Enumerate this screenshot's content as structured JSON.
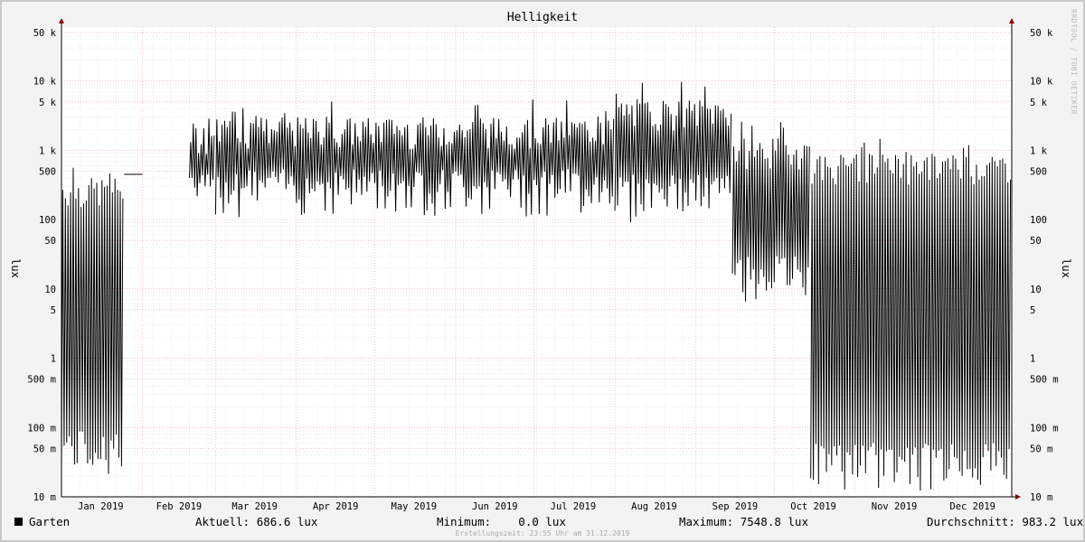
{
  "chart_data": {
    "type": "line",
    "title": "Helligkeit",
    "ylabel": "lux",
    "y_scale": "log",
    "ylim": [
      0.01,
      60000
    ],
    "y_ticks": [
      {
        "value": 50000,
        "label": "50 k"
      },
      {
        "value": 10000,
        "label": "10 k"
      },
      {
        "value": 5000,
        "label": "5 k"
      },
      {
        "value": 1000,
        "label": "1 k"
      },
      {
        "value": 500,
        "label": "500"
      },
      {
        "value": 100,
        "label": "100"
      },
      {
        "value": 50,
        "label": "50"
      },
      {
        "value": 10,
        "label": "10"
      },
      {
        "value": 5,
        "label": "5"
      },
      {
        "value": 1,
        "label": "1"
      },
      {
        "value": 0.5,
        "label": "500 m"
      },
      {
        "value": 0.1,
        "label": "100 m"
      },
      {
        "value": 0.05,
        "label": "50 m"
      },
      {
        "value": 0.01,
        "label": "10 m"
      }
    ],
    "x_range": [
      "2019-01-01",
      "2019-12-31"
    ],
    "x_ticks": [
      {
        "date": "2019-01-16",
        "label": "Jan 2019"
      },
      {
        "date": "2019-02-15",
        "label": "Feb 2019"
      },
      {
        "date": "2019-03-16",
        "label": "Mar 2019"
      },
      {
        "date": "2019-04-16",
        "label": "Apr 2019"
      },
      {
        "date": "2019-05-16",
        "label": "May 2019"
      },
      {
        "date": "2019-06-16",
        "label": "Jun 2019"
      },
      {
        "date": "2019-07-16",
        "label": "Jul 2019"
      },
      {
        "date": "2019-08-16",
        "label": "Aug 2019"
      },
      {
        "date": "2019-09-16",
        "label": "Sep 2019"
      },
      {
        "date": "2019-10-16",
        "label": "Oct 2019"
      },
      {
        "date": "2019-11-16",
        "label": "Nov 2019"
      },
      {
        "date": "2019-12-16",
        "label": "Dec 2019"
      }
    ],
    "grid": true,
    "series": [
      {
        "name": "Garten",
        "color": "#000000",
        "segments": [
          {
            "from": "2019-01-01",
            "to": "2019-01-25",
            "kind": "daily",
            "day_peak": 400,
            "night_min": 0.03
          },
          {
            "from": "2019-01-25",
            "to": "2019-02-01",
            "kind": "constant",
            "value": 450
          },
          {
            "from": "2019-02-19",
            "to": "2019-03-01",
            "kind": "daily",
            "day_peak": 2500,
            "night_min": 150
          },
          {
            "from": "2019-03-01",
            "to": "2019-08-01",
            "kind": "daily",
            "day_peak": 3000,
            "night_min": 180
          },
          {
            "from": "2019-08-01",
            "to": "2019-09-15",
            "kind": "daily",
            "day_peak": 5500,
            "night_min": 150
          },
          {
            "from": "2019-09-15",
            "to": "2019-10-15",
            "kind": "daily",
            "day_peak": 1500,
            "night_min": 10
          },
          {
            "from": "2019-10-15",
            "to": "2019-12-31",
            "kind": "daily",
            "day_peak": 900,
            "night_min": 0.02
          }
        ]
      }
    ],
    "stats": {
      "current": "Aktuell: 686.6 lux",
      "minimum": "Minimum:    0.0 lux",
      "maximum": "Maximum: 7548.8 lux",
      "average": "Durchschnitt: 983.2 lux"
    }
  },
  "legend": {
    "label": "Garten"
  },
  "watermark": "RRDTOOL / TOBI OETIKER",
  "footer": "Erstellungszeit: 23:55 Uhr am 31.12.2019"
}
